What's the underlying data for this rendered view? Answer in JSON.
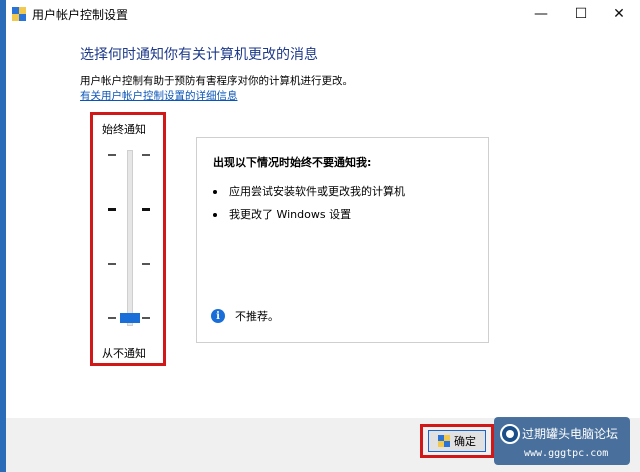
{
  "window": {
    "title": "用户帐户控制设置",
    "controls": {
      "minimize": "—",
      "maximize": "☐",
      "close": "✕"
    }
  },
  "main": {
    "heading": "选择何时通知你有关计算机更改的消息",
    "description": "用户帐户控制有助于预防有害程序对你的计算机进行更改。",
    "link": "有关用户帐户控制设置的详细信息"
  },
  "slider": {
    "top_label": "始终通知",
    "bottom_label": "从不通知",
    "levels": 4,
    "selected_level": 0,
    "accent_color": "#1a6ed8"
  },
  "info_panel": {
    "title": "出现以下情况时始终不要通知我:",
    "bullets": [
      "应用尝试安装软件或更改我的计算机",
      "我更改了 Windows 设置"
    ],
    "note": "不推荐。"
  },
  "footer": {
    "ok_label": "确定"
  },
  "watermark": {
    "text": "过期罐头电脑论坛",
    "url": "www.gggtpc.com"
  },
  "colors": {
    "highlight_border": "#d01818",
    "heading": "#1e3a8a",
    "link": "#0b55b8"
  }
}
